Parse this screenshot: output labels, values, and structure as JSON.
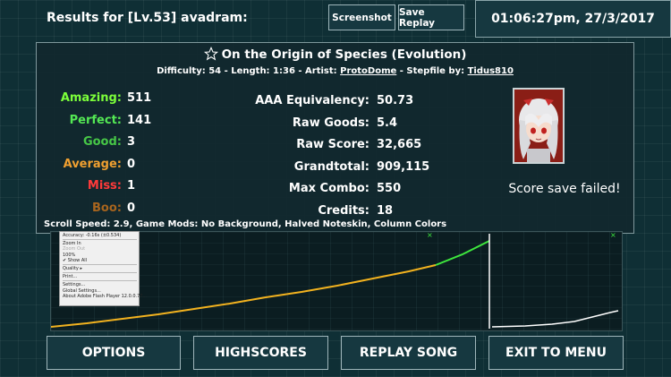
{
  "header": {
    "results_title": "Results for [Lv.53] avadram:",
    "screenshot_label": "Screenshot",
    "save_replay_label": "Save Replay",
    "clock": "01:06:27pm, 27/3/2017"
  },
  "song": {
    "title": "On the Origin of Species (Evolution)",
    "difficulty_prefix": "Difficulty: 54 - Length: 1:36 - Artist: ",
    "artist": "ProtoDome",
    "stepfile_prefix": " - Stepfile by: ",
    "stepfile_author": "Tidus810"
  },
  "judgements": [
    {
      "label": "Amazing:",
      "value": "511",
      "color": "#7cff3a"
    },
    {
      "label": "Perfect:",
      "value": "141",
      "color": "#54e854"
    },
    {
      "label": "Good:",
      "value": "3",
      "color": "#47c847"
    },
    {
      "label": "Average:",
      "value": "0",
      "color": "#f0a030"
    },
    {
      "label": "Miss:",
      "value": "1",
      "color": "#ff3a3a"
    },
    {
      "label": "Boo:",
      "value": "0",
      "color": "#a8651e"
    }
  ],
  "stats": [
    {
      "label": "AAA Equivalency:",
      "value": "50.73"
    },
    {
      "label": "Raw Goods:",
      "value": "5.4"
    },
    {
      "label": "Raw Score:",
      "value": "32,665"
    },
    {
      "label": "Grandtotal:",
      "value": "909,115"
    },
    {
      "label": "Max Combo:",
      "value": "550"
    },
    {
      "label": "Credits:",
      "value": "18"
    }
  ],
  "save_message": "Score save failed!",
  "mods_line": "Scroll Speed: 2.9, Game Mods: No Background, Halved Noteskin, Column Colors",
  "context_menu": {
    "items": [
      "Accuracy: -0.16s (±0.534)",
      "Zoom In",
      "Zoom Out",
      "100%",
      "Show All",
      "Quality",
      "Print...",
      "Settings...",
      "Global Settings...",
      "About Adobe Flash Player 12.0.0.77..."
    ]
  },
  "bottom_buttons": {
    "options": "OPTIONS",
    "highscores": "HIGHSCORES",
    "replay": "REPLAY SONG",
    "exit": "EXIT TO MENU"
  },
  "colors": {
    "accuracy_line": "#f2b21f",
    "combo_line": "#3ee83e",
    "miss_line": "#ffffff"
  }
}
